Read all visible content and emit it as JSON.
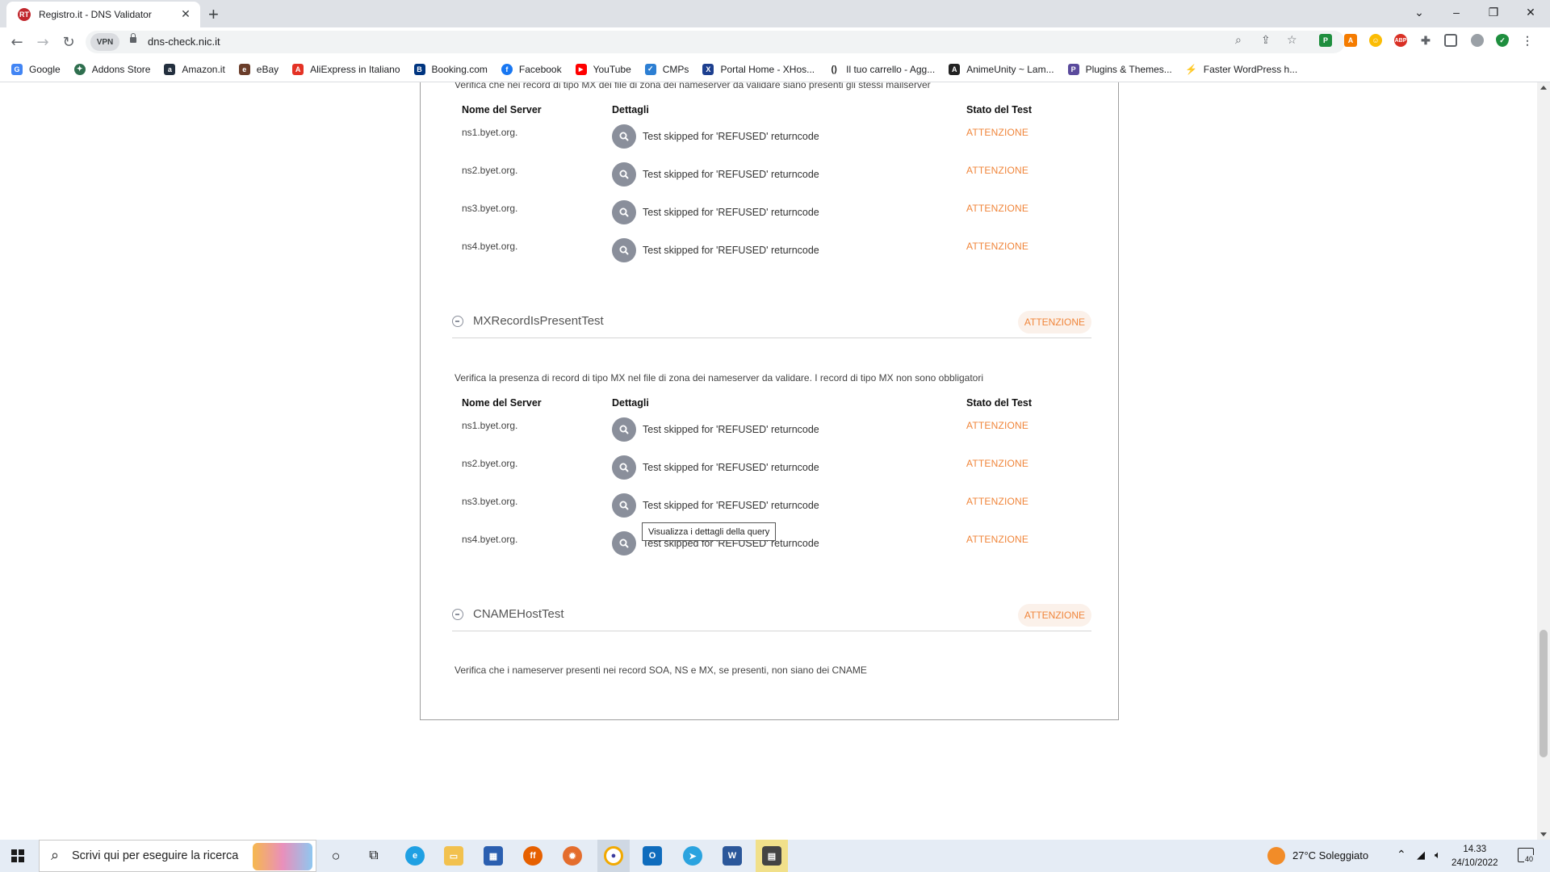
{
  "browser": {
    "tab_title": "Registro.it - DNS Validator",
    "tab_favicon": "RT",
    "new_tab": "+",
    "url": "dns-check.nic.it",
    "vpn_label": "VPN",
    "window_controls": [
      "⌄",
      "–",
      "❐",
      "✕"
    ]
  },
  "bookmarks": [
    {
      "label": "Google",
      "icon": "G",
      "color": "#4285f4"
    },
    {
      "label": "Addons Store",
      "icon": "✦",
      "color": "#2f6f4f"
    },
    {
      "label": "Amazon.it",
      "icon": "a",
      "color": "#232f3e"
    },
    {
      "label": "eBay",
      "icon": "e",
      "color": "#6a3d2a"
    },
    {
      "label": "AliExpress in Italiano",
      "icon": "A",
      "color": "#e43225"
    },
    {
      "label": "Booking.com",
      "icon": "B",
      "color": "#003580"
    },
    {
      "label": "Facebook",
      "icon": "f",
      "color": "#1877f2"
    },
    {
      "label": "YouTube",
      "icon": "▶",
      "color": "#ff0000"
    },
    {
      "label": "CMPs",
      "icon": "✓",
      "color": "#2d7fd3"
    },
    {
      "label": "Portal Home - XHos...",
      "icon": "X",
      "color": "#1d3f8f"
    },
    {
      "label": "Il tuo carrello - Agg...",
      "icon": "()",
      "color": "#ffffff"
    },
    {
      "label": "AnimeUnity ~ Lam...",
      "icon": "A",
      "color": "#222222"
    },
    {
      "label": "Plugins & Themes...",
      "icon": "P",
      "color": "#5a4a9c"
    },
    {
      "label": "Faster WordPress h...",
      "icon": "⚡",
      "color": "#f7a600"
    }
  ],
  "page": {
    "top_desc": "Verifica che nei record di tipo MX dei file di zona dei nameserver da validare siano presenti gli stessi mailserver",
    "columns": {
      "server": "Nome del Server",
      "details": "Dettagli",
      "status": "Stato del Test"
    },
    "table1": [
      {
        "server": "ns1.byet.org.",
        "detail": "Test skipped for 'REFUSED' returncode",
        "status": "ATTENZIONE"
      },
      {
        "server": "ns2.byet.org.",
        "detail": "Test skipped for 'REFUSED' returncode",
        "status": "ATTENZIONE"
      },
      {
        "server": "ns3.byet.org.",
        "detail": "Test skipped for 'REFUSED' returncode",
        "status": "ATTENZIONE"
      },
      {
        "server": "ns4.byet.org.",
        "detail": "Test skipped for 'REFUSED' returncode",
        "status": "ATTENZIONE"
      }
    ],
    "section_mx": {
      "title": "MXRecordIsPresentTest",
      "badge": "ATTENZIONE",
      "desc": "Verifica la presenza di record di tipo MX nel file di zona dei nameserver da validare. I record di tipo MX non sono obbligatori"
    },
    "table2": [
      {
        "server": "ns1.byet.org.",
        "detail": "Test skipped for 'REFUSED' returncode",
        "status": "ATTENZIONE"
      },
      {
        "server": "ns2.byet.org.",
        "detail": "Test skipped for 'REFUSED' returncode",
        "status": "ATTENZIONE"
      },
      {
        "server": "ns3.byet.org.",
        "detail": "Test skipped for 'REFUSED' returncode",
        "status": "ATTENZIONE"
      },
      {
        "server": "ns4.byet.org.",
        "detail": "Test skipped for 'REFUSED' returncode",
        "status": "ATTENZIONE"
      }
    ],
    "tooltip": "Visualizza i dettagli della query",
    "section_cname": {
      "title": "CNAMEHostTest",
      "badge": "ATTENZIONE",
      "desc": "Verifica che i nameserver presenti nei record SOA, NS e MX, se presenti, non siano dei CNAME"
    }
  },
  "taskbar": {
    "search_placeholder": "Scrivi qui per eseguire la ricerca",
    "weather": "27°C  Soleggiato",
    "time": "14.33",
    "date": "24/10/2022",
    "notifications": "40"
  },
  "colors": {
    "warning": "#f0853a",
    "detail_button": "#8a8f9b"
  }
}
